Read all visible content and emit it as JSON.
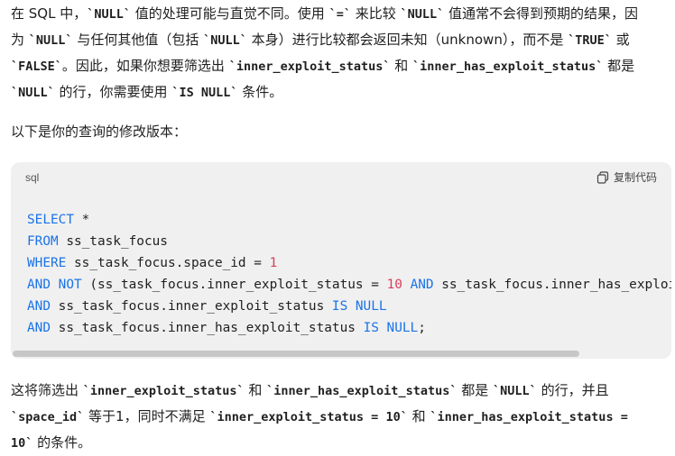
{
  "para1": {
    "l1": [
      "在 SQL 中，",
      "`NULL`",
      " 值的处理可能与直觉不同。使用 ",
      "`=`",
      " 来比较 ",
      "`NULL`",
      " 值通常不会得到预期的结果，因"
    ],
    "l2": [
      "为 ",
      "`NULL`",
      " 与任何其他值（包括 ",
      "`NULL`",
      " 本身）进行比较都会返回未知（unknown），而不是 ",
      "`TRUE`",
      " 或"
    ],
    "l3": [
      "`FALSE`",
      "。因此，如果你想要筛选出 ",
      "`inner_exploit_status`",
      " 和 ",
      "`inner_has_exploit_status`",
      " 都是"
    ],
    "l4": [
      "`NULL`",
      " 的行，你需要使用 ",
      "`IS NULL`",
      " 条件。"
    ]
  },
  "para2": "以下是你的查询的修改版本：",
  "code_block": {
    "language": "sql",
    "copy_label": "复制代码",
    "lines": [
      [
        [
          "kw",
          "SELECT"
        ],
        [
          "t",
          " *"
        ]
      ],
      [
        [
          "kw",
          "FROM"
        ],
        [
          "t",
          " ss_task_focus"
        ]
      ],
      [
        [
          "kw",
          "WHERE"
        ],
        [
          "t",
          " ss_task_focus.space_id = "
        ],
        [
          "num",
          "1"
        ]
      ],
      [
        [
          "kw",
          "AND NOT"
        ],
        [
          "t",
          " (ss_task_focus.inner_exploit_status = "
        ],
        [
          "num",
          "10"
        ],
        [
          "t",
          " "
        ],
        [
          "kw",
          "AND"
        ],
        [
          "t",
          " ss_task_focus.inner_has_exploit_"
        ]
      ],
      [
        [
          "kw",
          "AND"
        ],
        [
          "t",
          " ss_task_focus.inner_exploit_status "
        ],
        [
          "kw",
          "IS NULL"
        ]
      ],
      [
        [
          "kw",
          "AND"
        ],
        [
          "t",
          " ss_task_focus.inner_has_exploit_status "
        ],
        [
          "kw",
          "IS NULL"
        ],
        [
          "t",
          ";"
        ]
      ]
    ]
  },
  "para3": {
    "l1": [
      "这将筛选出 ",
      "`inner_exploit_status`",
      " 和 ",
      "`inner_has_exploit_status`",
      " 都是 ",
      "`NULL`",
      " 的行，并且"
    ],
    "l2": [
      "`space_id`",
      " 等于1，同时不满足 ",
      "`inner_exploit_status = 10`",
      " 和 ",
      "`inner_has_exploit_status =",
      ""
    ],
    "l3": [
      "10`",
      " 的条件。"
    ]
  },
  "colors": {
    "keyword": "#1a73e8",
    "number": "#d93d5b",
    "code_bg": "#f0f0f0"
  },
  "icons": {
    "copy": "copy-icon"
  }
}
